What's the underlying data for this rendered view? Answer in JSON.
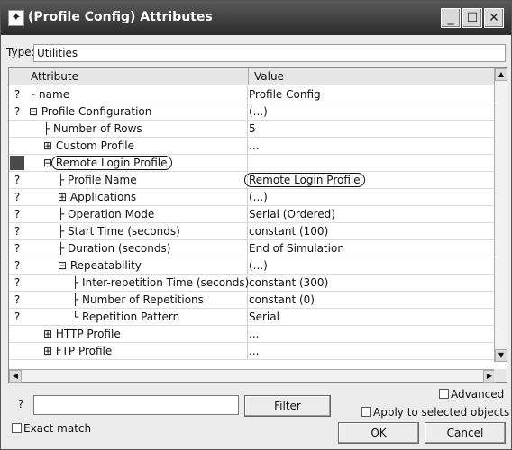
{
  "window": {
    "title": "(Profile Config) Attributes",
    "icon": "star-icon",
    "controls": [
      "minimize",
      "maximize",
      "close"
    ]
  },
  "type_field": {
    "label": "Type:",
    "value": "Utilities"
  },
  "grid": {
    "headers": [
      "Attribute",
      "Value"
    ],
    "rows": [
      {
        "icon": "help",
        "tree": "┌",
        "attribute": "name",
        "value": "Profile Config",
        "indent": 0
      },
      {
        "icon": "help",
        "tree": "⊟",
        "attribute": "Profile Configuration",
        "value": "(...)",
        "indent": 0
      },
      {
        "icon": "none",
        "tree": "├",
        "attribute": "Number of Rows",
        "value": "5",
        "indent": 1
      },
      {
        "icon": "none",
        "tree": "⊞",
        "attribute": "Custom Profile",
        "value": "...",
        "indent": 1
      },
      {
        "icon": "marker",
        "tree": "⊟",
        "attribute": "Remote Login Profile",
        "value": "",
        "indent": 1,
        "highlight": true
      },
      {
        "icon": "help",
        "tree": "├",
        "attribute": "Profile Name",
        "value": "Remote Login Profile",
        "indent": 2,
        "value_highlight": true
      },
      {
        "icon": "help",
        "tree": "⊞",
        "attribute": "Applications",
        "value": "(...)",
        "indent": 2
      },
      {
        "icon": "help",
        "tree": "├",
        "attribute": "Operation Mode",
        "value": "Serial (Ordered)",
        "indent": 2
      },
      {
        "icon": "help",
        "tree": "├",
        "attribute": "Start Time (seconds)",
        "value": "constant (100)",
        "indent": 2
      },
      {
        "icon": "help",
        "tree": "├",
        "attribute": "Duration (seconds)",
        "value": "End of Simulation",
        "indent": 2
      },
      {
        "icon": "help",
        "tree": "⊟",
        "attribute": "Repeatability",
        "value": "(...)",
        "indent": 2
      },
      {
        "icon": "help",
        "tree": "├",
        "attribute": "Inter-repetition Time (seconds)",
        "value": "constant (300)",
        "indent": 3
      },
      {
        "icon": "help",
        "tree": "├",
        "attribute": "Number of Repetitions",
        "value": "constant (0)",
        "indent": 3
      },
      {
        "icon": "help",
        "tree": "└",
        "attribute": "Repetition Pattern",
        "value": "Serial",
        "indent": 3
      },
      {
        "icon": "none",
        "tree": "⊞",
        "attribute": "HTTP Profile",
        "value": "...",
        "indent": 1
      },
      {
        "icon": "none",
        "tree": "⊞",
        "attribute": "FTP Profile",
        "value": "...",
        "indent": 1
      }
    ]
  },
  "bottom": {
    "filter_button": "Filter",
    "filter_value": "",
    "advanced_label": "Advanced",
    "exact_match_label": "Exact match",
    "apply_label": "Apply to selected objects",
    "ok_label": "OK",
    "cancel_label": "Cancel"
  }
}
